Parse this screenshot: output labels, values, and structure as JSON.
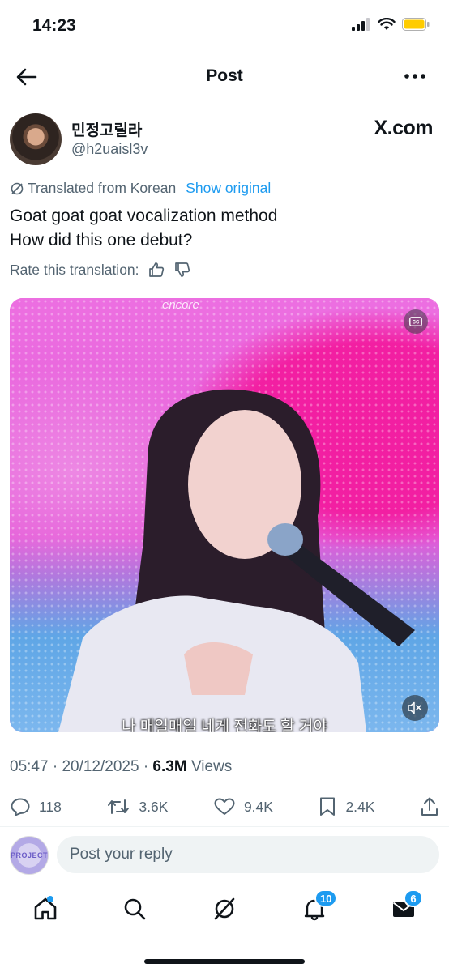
{
  "status_bar": {
    "time": "14:23"
  },
  "nav": {
    "title": "Post"
  },
  "author": {
    "name": "민정고릴라",
    "handle": "@h2uaisl3v",
    "source": "X.com"
  },
  "translation": {
    "label": "Translated from Korean",
    "show_original": "Show original",
    "rate_label": "Rate this translation:"
  },
  "post": {
    "line1": "Goat goat goat vocalization method",
    "line2": "How did this one debut?"
  },
  "media": {
    "watermark": "encore",
    "subtitle": "나 매일매일 네게 전화도 할 거야"
  },
  "meta": {
    "time": "05:47",
    "separator": "·",
    "date": "20/12/2025",
    "views_count": "6.3M",
    "views_label": "Views"
  },
  "actions": {
    "replies": "118",
    "reposts": "3.6K",
    "likes": "9.4K",
    "bookmarks": "2.4K"
  },
  "reply": {
    "placeholder": "Post your reply",
    "avatar_text": "PROJECT"
  },
  "tabbar": {
    "notifications_badge": "10",
    "messages_badge": "6"
  },
  "colors": {
    "accent": "#1d9bf0",
    "text": "#0f1419",
    "secondary": "#536471"
  }
}
